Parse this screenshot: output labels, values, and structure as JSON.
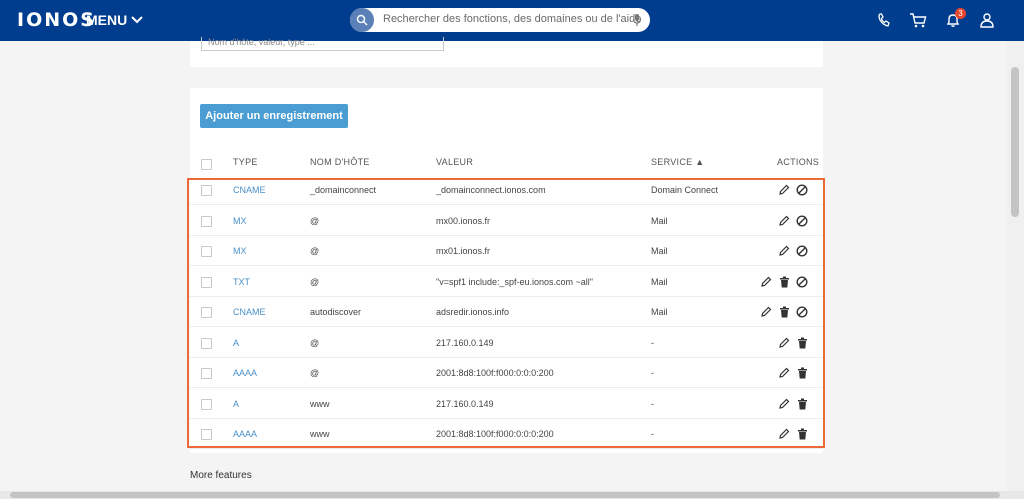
{
  "header": {
    "logo": "IONOS",
    "menu_label": "MENU",
    "search_placeholder": "Rechercher des fonctions, des domaines ou de l'aide",
    "notification_count": "3"
  },
  "filter": {
    "placeholder": "Nom d'hôte, valeur, type ..."
  },
  "toolbar": {
    "add_label": "Ajouter un enregistrement"
  },
  "table": {
    "columns": {
      "type": "TYPE",
      "host": "NOM D'HÔTE",
      "value": "VALEUR",
      "service": "SERVICE ▲",
      "actions": "ACTIONS"
    },
    "rows": [
      {
        "type": "CNAME",
        "host": "_domainconnect",
        "value": "_domainconnect.ionos.com",
        "service": "Domain Connect",
        "actions": [
          "edit",
          "block"
        ]
      },
      {
        "type": "MX",
        "host": "@",
        "value": "mx00.ionos.fr",
        "service": "Mail",
        "actions": [
          "edit",
          "block"
        ]
      },
      {
        "type": "MX",
        "host": "@",
        "value": "mx01.ionos.fr",
        "service": "Mail",
        "actions": [
          "edit",
          "block"
        ]
      },
      {
        "type": "TXT",
        "host": "@",
        "value": "\"v=spf1 include:_spf-eu.ionos.com ~all\"",
        "service": "Mail",
        "actions": [
          "edit",
          "delete",
          "block"
        ]
      },
      {
        "type": "CNAME",
        "host": "autodiscover",
        "value": "adsredir.ionos.info",
        "service": "Mail",
        "actions": [
          "edit",
          "delete",
          "block"
        ]
      },
      {
        "type": "A",
        "host": "@",
        "value": "217.160.0.149",
        "service": "-",
        "actions": [
          "edit",
          "delete"
        ]
      },
      {
        "type": "AAAA",
        "host": "@",
        "value": "2001:8d8:100f:f000:0:0:0:200",
        "service": "-",
        "actions": [
          "edit",
          "delete"
        ]
      },
      {
        "type": "A",
        "host": "www",
        "value": "217.160.0.149",
        "service": "-",
        "actions": [
          "edit",
          "delete"
        ]
      },
      {
        "type": "AAAA",
        "host": "www",
        "value": "2001:8d8:100f:f000:0:0:0:200",
        "service": "-",
        "actions": [
          "edit",
          "delete"
        ]
      }
    ]
  },
  "footer": {
    "more_features": "More features"
  },
  "colors": {
    "nav": "#003d8f",
    "accent": "#4a9dd3",
    "highlight": "#ec6a3a",
    "link": "#4a8fc6"
  }
}
